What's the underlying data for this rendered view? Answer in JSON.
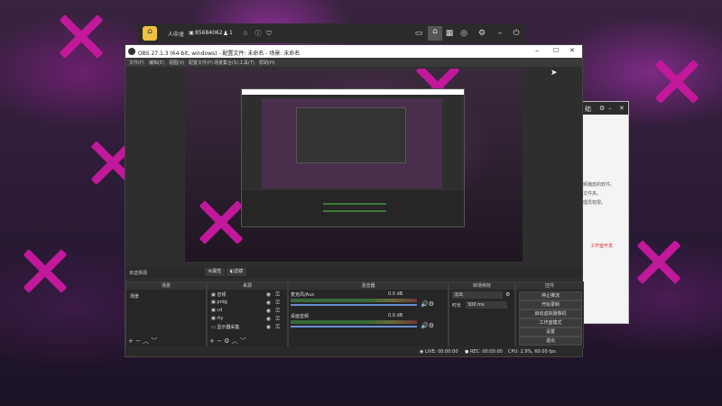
{
  "topbar": {
    "user_name": "人中龙",
    "user_id": "85684062",
    "viewer_count": "1",
    "icons": [
      "home-icon",
      "person-icon",
      "star-icon",
      "info-icon",
      "shield-icon",
      "camera-icon",
      "grid-icon",
      "gamepad-icon",
      "settings-icon",
      "power-icon"
    ]
  },
  "obs": {
    "title": "OBS 27.1.3 (64-bit, windows) - 配置文件: 未命名 - 场景: 未命名",
    "menus": [
      "文件(F)",
      "编辑(E)",
      "视图(V)",
      "配置文件(P)",
      "场景集合(S)",
      "工具(T)",
      "帮助(H)"
    ],
    "no_source_selected": "未选择源",
    "properties_label": "属性",
    "filters_label": "滤镜",
    "docks": {
      "scenes": "场景",
      "sources": "来源",
      "mixer": "混音器",
      "transitions": "转场特效",
      "controls": "控件"
    },
    "scenes": [
      "场景"
    ],
    "sources": [
      "音频",
      "prdg",
      "cd",
      "rty",
      "显示器采集"
    ],
    "mixer": [
      {
        "name": "麦克风/Aux",
        "value": "0.0 dB"
      },
      {
        "name": "桌面音频",
        "value": "0.0 dB"
      }
    ],
    "transition": {
      "type": "淡出",
      "duration_label": "时长",
      "duration": "300 ms"
    },
    "controls": [
      "停止推流",
      "开始录制",
      "启动虚拟摄像机",
      "工作室模式",
      "设置",
      "退出"
    ],
    "status": {
      "live": "LIVE: 00:00:00",
      "rec": "REC: 00:00:00",
      "cpu": "CPU: 2.9%, 60.00 fps"
    }
  },
  "side_window": {
    "title": "础",
    "lines": [
      "频播放的软件。",
      "文件夹。",
      "理员权限。",
      "工作室开发"
    ],
    "link": "工作室开发"
  },
  "colors": {
    "accent_pink": "#c2189a",
    "obs_bg": "#2e2e2e"
  }
}
